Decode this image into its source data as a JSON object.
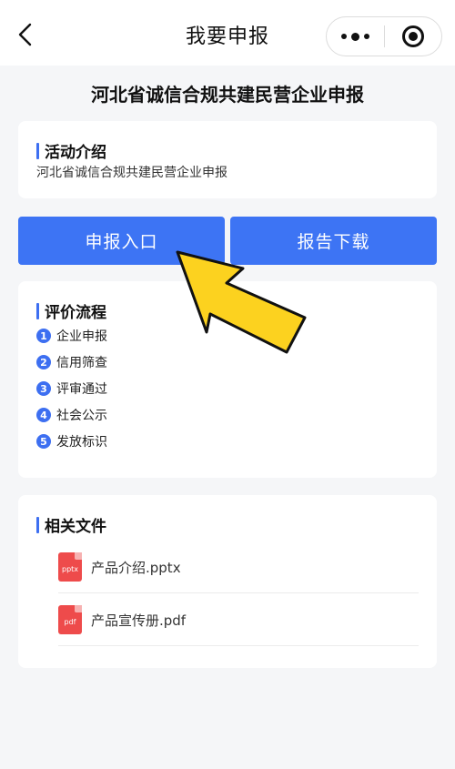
{
  "nav": {
    "title": "我要申报"
  },
  "page": {
    "title": "河北省诚信合规共建民营企业申报"
  },
  "intro": {
    "heading": "活动介绍",
    "text": "河北省诚信合规共建民营企业申报"
  },
  "actions": {
    "apply_label": "申报入口",
    "download_label": "报告下载"
  },
  "process": {
    "heading": "评价流程",
    "steps": [
      {
        "num": "1",
        "label": "企业申报"
      },
      {
        "num": "2",
        "label": "信用筛查"
      },
      {
        "num": "3",
        "label": "评审通过"
      },
      {
        "num": "4",
        "label": "社会公示"
      },
      {
        "num": "5",
        "label": "发放标识"
      }
    ]
  },
  "files": {
    "heading": "相关文件",
    "items": [
      {
        "icon_text": "pptx",
        "name": "产品介绍.pptx"
      },
      {
        "icon_text": "pdf",
        "name": "产品宣传册.pdf"
      }
    ]
  },
  "colors": {
    "accent": "#3d74f4",
    "file_icon": "#ee4b4b",
    "arrow_fill": "#fcd21f"
  }
}
